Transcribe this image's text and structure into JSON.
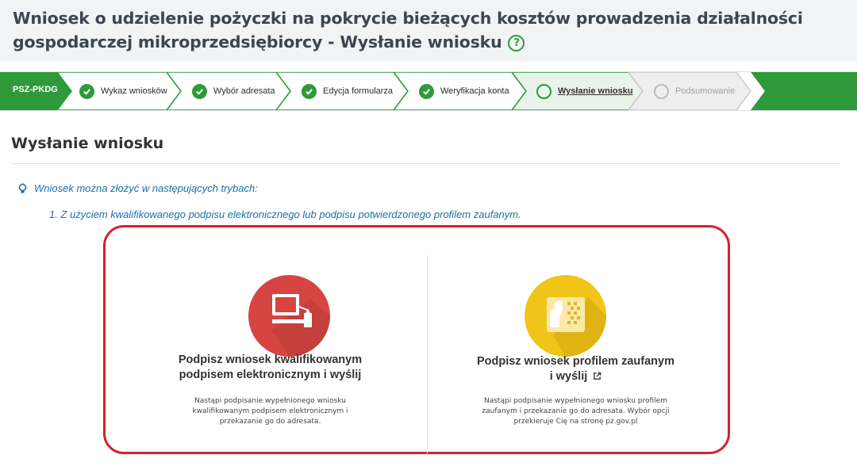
{
  "header": {
    "title": "Wniosek o udzielenie pożyczki na pokrycie bieżących kosztów prowadzenia działalności gospodarczej mikroprzedsiębiorcy - Wysłanie wniosku",
    "help_icon": "help-circle-icon"
  },
  "stepper": {
    "code": "PSZ-PKDG",
    "steps": [
      {
        "label": "Wykaz wniosków",
        "state": "done"
      },
      {
        "label": "Wybór adresata",
        "state": "done"
      },
      {
        "label": "Edycja formularza",
        "state": "done"
      },
      {
        "label": "Weryfikacja konta",
        "state": "done"
      },
      {
        "label": "Wysłanie wniosku",
        "state": "current"
      },
      {
        "label": "Podsumowanie",
        "state": "future"
      }
    ],
    "colors": {
      "done": "#2e9a3a",
      "current": "#e8f4e9",
      "future": "#eeeeee"
    }
  },
  "section": {
    "title": "Wysłanie wniosku",
    "info": "Wniosek można złożyć w następujących trybach:",
    "mode_1": "1. Z użyciem kwalifikowanego podpisu elektronicznego lub podpisu potwierdzonego profilem zaufanym."
  },
  "options": {
    "qualified": {
      "icon": "computer-signature-icon",
      "color": "#d64541",
      "title_line1": "Podpisz wniosek kwalifikowanym",
      "title_line2": "podpisem elektronicznym i wyślij",
      "desc_line1": "Nastąpi podpisanie wypełnionego wniosku",
      "desc_line2": "kwalifikowanym podpisem elektronicznym i",
      "desc_line3": "przekazanie go do adresata."
    },
    "trusted": {
      "icon": "trusted-profile-icon",
      "color": "#f0c419",
      "title_line1": "Podpisz wniosek profilem zaufanym",
      "title_line2": "i wyślij",
      "external_icon": "external-link-icon",
      "desc_line1": "Nastąpi podpisanie wypełnionego wniosku profilem",
      "desc_line2": "zaufanym i przekazanie go do adresata. Wybór opcji",
      "desc_line3": "przekieruje Cię na stronę pz.gov.pl"
    }
  },
  "highlight_color": "#d9202a"
}
